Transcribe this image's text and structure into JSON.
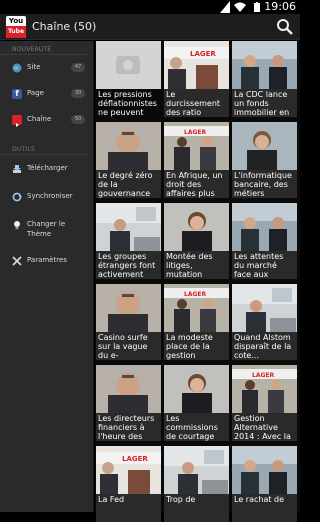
{
  "status": {
    "time": "19:06"
  },
  "app": {
    "title": "Chaîne (50)",
    "logo_top": "You",
    "logo_bottom": "Tube"
  },
  "drawer": {
    "section_new": "NOUVEAUTÉ",
    "items": [
      {
        "label": "Site",
        "count": "47",
        "color": "#4a8fd4"
      },
      {
        "label": "Page",
        "count": "30",
        "color": "#3b5998"
      },
      {
        "label": "Chaîne",
        "count": "50",
        "color": "#d8232a"
      }
    ],
    "section_tools": "OUTILS",
    "tools": [
      {
        "label": "Télécharger"
      },
      {
        "label": "Synchroniser"
      },
      {
        "label": "Changer le Thème"
      },
      {
        "label": "Paramètres"
      }
    ]
  },
  "videos": [
    {
      "title": "Les pressions déflationnistes ne peuvent que",
      "scene": "empty"
    },
    {
      "title": "Le durcissement des ratio",
      "scene": "banner"
    },
    {
      "title": "La CDC lance un fonds immobilier en",
      "scene": "duo"
    },
    {
      "title": "Le degré zéro de la gouvernance",
      "scene": "closeup"
    },
    {
      "title": "En Afrique, un droit des affaires plus",
      "scene": "pair"
    },
    {
      "title": "L'informatique bancaire, des métiers",
      "scene": "woman"
    },
    {
      "title": "Les groupes étrangers font activement",
      "scene": "office"
    },
    {
      "title": "Montée des litiges, mutation",
      "scene": "woman2"
    },
    {
      "title": "Les attentes du marché face aux enjeux du",
      "scene": "duo"
    },
    {
      "title": "Casino surfe sur la vague du e-commerce",
      "scene": "closeup"
    },
    {
      "title": "La modeste place de la gestion",
      "scene": "pair"
    },
    {
      "title": "Quand Alstom disparaît de la cote...",
      "scene": "office"
    },
    {
      "title": "Les directeurs financiers à l'heure des",
      "scene": "closeup"
    },
    {
      "title": "Les commissions de courtage",
      "scene": "woman2"
    },
    {
      "title": "Gestion Alternative 2014 : Avec la",
      "scene": "pair"
    },
    {
      "title": "La Fed",
      "scene": "banner"
    },
    {
      "title": "Trop de",
      "scene": "office"
    },
    {
      "title": "Le rachat de",
      "scene": "duo"
    }
  ]
}
